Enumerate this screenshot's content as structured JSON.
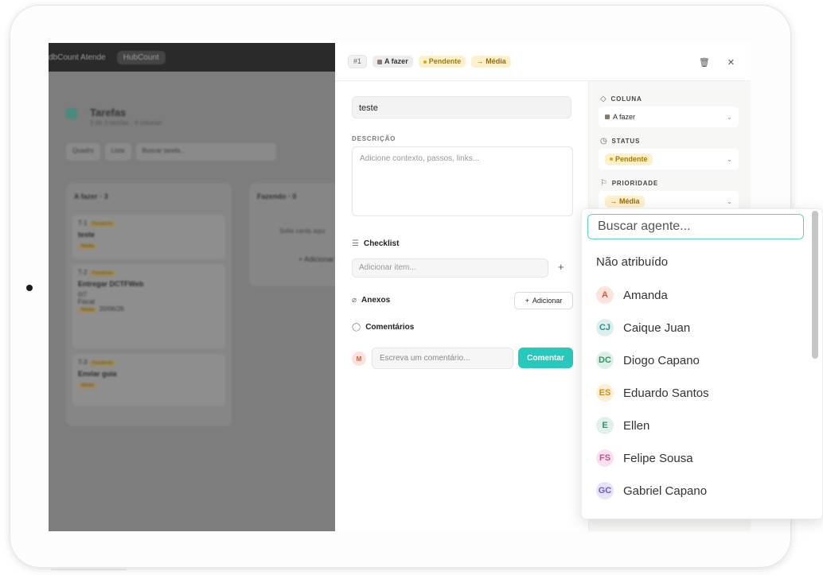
{
  "background": {
    "app_tabs": [
      "dbCount Atende",
      "HubCount"
    ],
    "title": "Tarefas",
    "subtitle": "3 de 3 tarefas · 4 colunas",
    "views": [
      "Quadro",
      "Lista",
      "Buscar tarefa..."
    ],
    "columns": [
      {
        "name": "A fazer",
        "count": "3"
      },
      {
        "name": "Fazendo",
        "count": "0",
        "empty_text": "Solte cards aqui",
        "add": "+ Adicionar"
      }
    ],
    "cards": [
      {
        "id": "T-1",
        "status": "Pendente",
        "title": "teste",
        "priority": "Média"
      },
      {
        "id": "T-2",
        "status": "Pendente",
        "title": "Entregar DCTFWeb",
        "checklist": "0/7",
        "tag": "Fiscal",
        "priority": "Média",
        "date": "20/06/26"
      },
      {
        "id": "T-3",
        "status": "Pendente",
        "title": "Enviar guia",
        "priority": "Média"
      }
    ]
  },
  "header": {
    "number": "#1",
    "column": "A fazer",
    "status": "Pendente",
    "priority": "Média"
  },
  "form": {
    "title_value": "teste",
    "description_label": "DESCRIÇÃO",
    "description_placeholder": "Adicione contexto, passos, links...",
    "checklist_label": "Checklist",
    "checklist_placeholder": "Adicionar item...",
    "attachments_label": "Anexos",
    "attachments_add": "Adicionar",
    "comments_label": "Comentários",
    "comment_avatar": "M",
    "comment_placeholder": "Escreva um comentário...",
    "comment_button": "Comentar"
  },
  "sidebar": {
    "column_label": "COLUNA",
    "column_value": "A fazer",
    "status_label": "STATUS",
    "status_value": "Pendente",
    "priority_label": "PRIORIDADE",
    "priority_value": "Média"
  },
  "dropdown": {
    "search_placeholder": "Buscar agente...",
    "unassigned": "Não atribuído",
    "agents": [
      {
        "initials": "A",
        "name": "Amanda",
        "bg": "#fde3dc",
        "fg": "#d2573c"
      },
      {
        "initials": "CJ",
        "name": "Caique Juan",
        "bg": "#dcefee",
        "fg": "#2b8f88"
      },
      {
        "initials": "DC",
        "name": "Diogo Capano",
        "bg": "#dcf1e6",
        "fg": "#2e9a63"
      },
      {
        "initials": "ES",
        "name": "Eduardo Santos",
        "bg": "#fdefd5",
        "fg": "#d18a16"
      },
      {
        "initials": "E",
        "name": "Ellen",
        "bg": "#dff1ea",
        "fg": "#2f9470"
      },
      {
        "initials": "FS",
        "name": "Felipe Sousa",
        "bg": "#fbe0ee",
        "fg": "#c6508e"
      },
      {
        "initials": "GC",
        "name": "Gabriel Capano",
        "bg": "#e6e3fb",
        "fg": "#6b5cd3"
      }
    ]
  }
}
